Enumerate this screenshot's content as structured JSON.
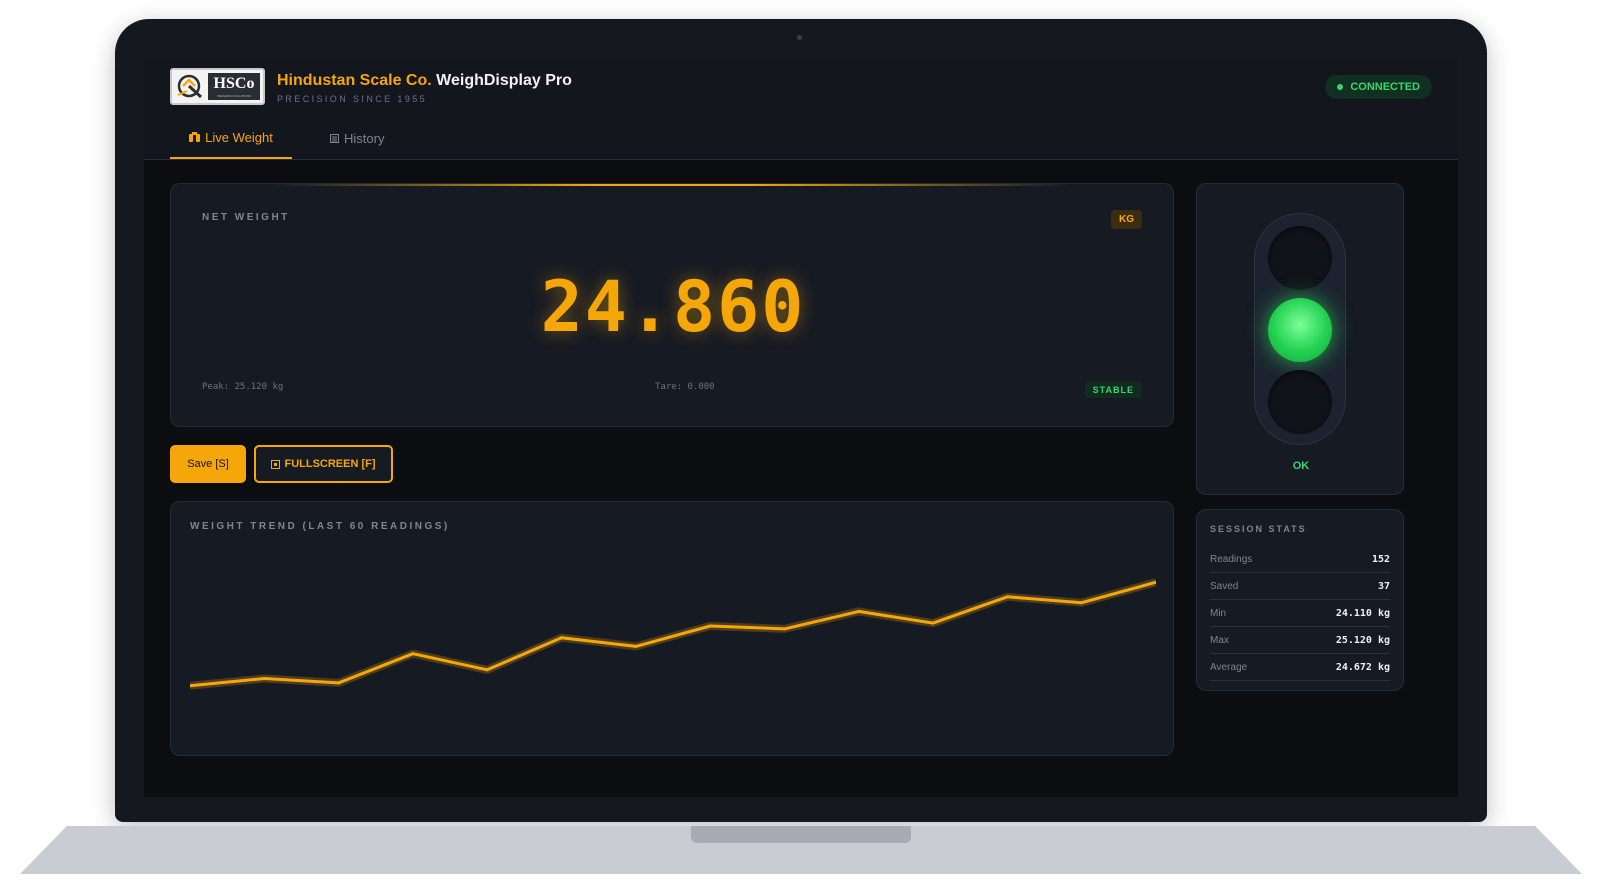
{
  "header": {
    "logo_text": "HSCo",
    "logo_subtext": "WEIGHING SOLUTIONS",
    "company": "Hindustan Scale Co.",
    "product": "WeighDisplay Pro",
    "tagline": "PRECISION SINCE 1955",
    "connection_status": "CONNECTED"
  },
  "tabs": [
    {
      "label": "Live Weight",
      "icon": "scale-icon",
      "active": true
    },
    {
      "label": "History",
      "icon": "list-icon",
      "active": false
    }
  ],
  "weight": {
    "label": "NET WEIGHT",
    "unit": "KG",
    "value": "24.860",
    "peak": "Peak: 25.120 kg",
    "tare": "Tare: 0.000",
    "status": "STABLE"
  },
  "actions": {
    "save_label": "Save [S]",
    "fullscreen_label": "FULLSCREEN [F]",
    "fullscreen_icon": "fullscreen-icon"
  },
  "trend": {
    "title": "WEIGHT TREND (LAST 60 READINGS)"
  },
  "chart_data": {
    "type": "line",
    "title": "WEIGHT TREND (LAST 60 READINGS)",
    "xlabel": "",
    "ylabel": "",
    "series": [
      {
        "values": [
          24.11,
          24.16,
          24.13,
          24.33,
          24.22,
          24.44,
          24.38,
          24.52,
          24.5,
          24.62,
          24.54,
          24.72,
          24.68,
          24.82
        ]
      }
    ],
    "ylim": [
      23.8,
      25.0
    ],
    "grid": false,
    "color": "#f5a70a"
  },
  "traffic_light": {
    "state": "green",
    "status_label": "OK"
  },
  "stats": {
    "title": "SESSION STATS",
    "rows": [
      {
        "label": "Readings",
        "value": "152"
      },
      {
        "label": "Saved",
        "value": "37"
      },
      {
        "label": "Min",
        "value": "24.110 kg"
      },
      {
        "label": "Max",
        "value": "25.120 kg"
      },
      {
        "label": "Average",
        "value": "24.672 kg"
      }
    ]
  },
  "colors": {
    "accent": "#f5a70a",
    "ok": "#39d66b",
    "background": "#0b0d11",
    "panel": "#161a23"
  }
}
